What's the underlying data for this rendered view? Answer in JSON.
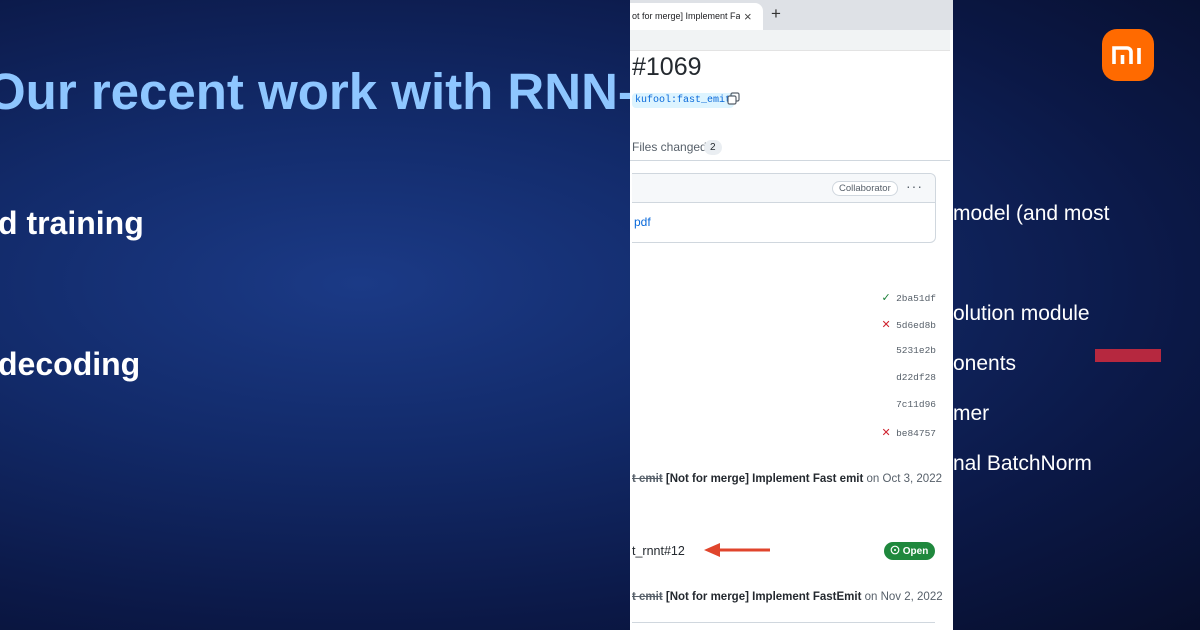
{
  "slide": {
    "title": "Our recent work with RNN-T",
    "left_items": [
      "d training",
      "decoding"
    ],
    "right_items": [
      "model (and most",
      "olution module",
      "onents",
      "mer",
      "nal BatchNorm"
    ],
    "logo_text": "mi",
    "colors": {
      "title": "#8ec6ff",
      "accent_bar": "#b6283f",
      "logo": "#ff6a00"
    }
  },
  "browser": {
    "tab_title": "ot for merge] Implement Fast",
    "tab_close": "×",
    "new_tab": "+"
  },
  "pr": {
    "number": "#1069",
    "branch": "kufool:fast_emit",
    "files_tab_label": "Files changed",
    "files_count": "2",
    "collaborator_badge": "Collaborator",
    "more_label": "···",
    "attachment_link": "pdf",
    "commits": [
      {
        "status": "success",
        "icon": "check-icon",
        "sha": "2ba51df"
      },
      {
        "status": "failure",
        "icon": "x-icon",
        "sha": "5d6ed8b"
      },
      {
        "status": "none",
        "icon": "",
        "sha": "5231e2b"
      },
      {
        "status": "none",
        "icon": "",
        "sha": "d22df28"
      },
      {
        "status": "none",
        "icon": "",
        "sha": "7c11d96"
      },
      {
        "status": "failure",
        "icon": "x-icon",
        "sha": "be84757"
      }
    ],
    "events": [
      {
        "old": "t emit",
        "new": "[Not for merge] Implement Fast emit",
        "on": "on",
        "date": "Oct 3, 2022"
      },
      {
        "old": "t emit",
        "new": "[Not for merge] Implement FastEmit",
        "on": "on",
        "date": "Nov 2, 2022"
      }
    ],
    "reference": "t_rnnt#12",
    "reference_state": "Open"
  }
}
